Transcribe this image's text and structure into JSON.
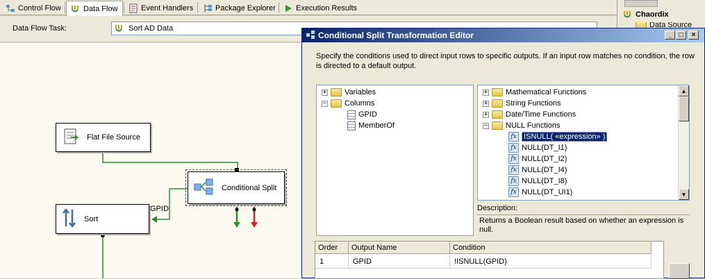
{
  "tabs": [
    {
      "label": "Control Flow",
      "icon": "control-flow-icon",
      "active": false
    },
    {
      "label": "Data Flow",
      "icon": "data-flow-icon",
      "active": true
    },
    {
      "label": "Event Handlers",
      "icon": "event-handlers-icon",
      "active": false
    },
    {
      "label": "Package Explorer",
      "icon": "package-explorer-icon",
      "active": false
    },
    {
      "label": "Execution Results",
      "icon": "execution-results-icon",
      "active": false
    }
  ],
  "task": {
    "label": "Data Flow Task:",
    "value": "Sort AD Data"
  },
  "canvas": {
    "components": {
      "flat_file_source": "Flat File Source",
      "conditional_split": "Conditional Split",
      "sort": "Sort"
    },
    "path_label": "GPID"
  },
  "right_pane": {
    "project": "Chaordix",
    "item": "Data Source"
  },
  "dialog": {
    "title": "Conditional Split Transformation Editor",
    "instructions": "Specify the conditions used to direct input rows to specific outputs. If an input row matches no condition, the row is directed to a default output.",
    "variables_tree": {
      "variables": "Variables",
      "columns": "Columns",
      "column_items": [
        "GPID",
        "MemberOf"
      ]
    },
    "functions_tree": {
      "folders": [
        "Mathematical Functions",
        "String Functions",
        "Date/Time Functions",
        "NULL Functions"
      ],
      "null_functions": [
        "ISNULL( «expression» )",
        "NULL(DT_I1)",
        "NULL(DT_I2)",
        "NULL(DT_I4)",
        "NULL(DT_I8)",
        "NULL(DT_UI1)"
      ],
      "selected": "ISNULL( «expression» )"
    },
    "description": {
      "label": "Description:",
      "text": "Returns a Boolean result based on whether an expression is null."
    },
    "grid": {
      "headers": [
        "Order",
        "Output Name",
        "Condition"
      ],
      "rows": [
        {
          "order": "1",
          "output_name": "GPID",
          "condition": "!ISNULL(GPID)"
        }
      ]
    }
  },
  "colors": {
    "selection": "#0a246a",
    "path_green": "#2e8b2e",
    "error_red": "#cc2222"
  }
}
